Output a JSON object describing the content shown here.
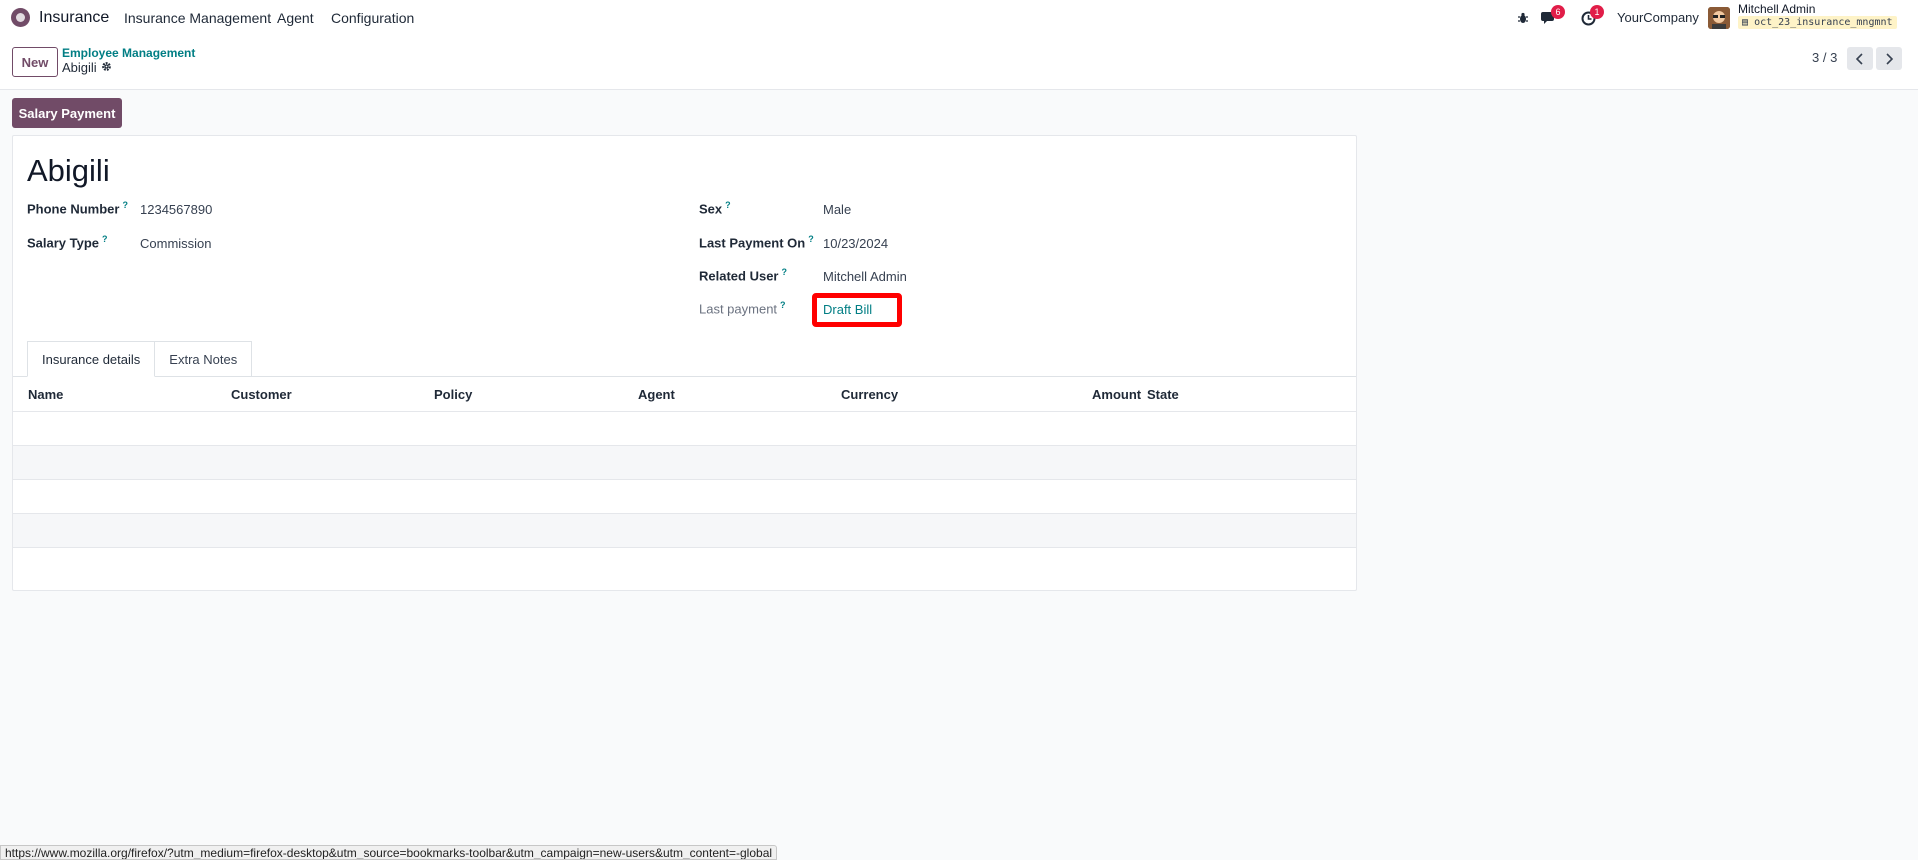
{
  "navbar": {
    "app_name": "Insurance",
    "menu": [
      "Insurance Management",
      "Agent",
      "Configuration"
    ],
    "messages_count": "6",
    "activities_count": "1",
    "company": "YourCompany",
    "user_name": "Mitchell Admin",
    "database": "oct_23_insurance_mngmnt"
  },
  "control_panel": {
    "new_label": "New",
    "breadcrumb_parent": "Employee Management",
    "breadcrumb_current": "Abigili",
    "pager": "3 / 3"
  },
  "form": {
    "action_button": "Salary Payment",
    "title": "Abigili",
    "fields_left": [
      {
        "label": "Phone Number",
        "value": "1234567890"
      },
      {
        "label": "Salary Type",
        "value": "Commission"
      }
    ],
    "fields_right": [
      {
        "label": "Sex",
        "value": "Male"
      },
      {
        "label": "Last Payment On",
        "value": "10/23/2024"
      },
      {
        "label": "Related User",
        "value": "Mitchell Admin"
      },
      {
        "label": "Last payment",
        "value": "Draft Bill"
      }
    ],
    "help_mark": "?",
    "tabs": [
      "Insurance details",
      "Extra Notes"
    ],
    "table_columns": [
      "Name",
      "Customer",
      "Policy",
      "Agent",
      "Currency",
      "Amount",
      "State"
    ]
  },
  "statusbar": {
    "url": "https://www.mozilla.org/firefox/?utm_medium=firefox-desktop&utm_source=bookmarks-toolbar&utm_campaign=new-users&utm_content=-global"
  },
  "colors": {
    "primary": "#714b67",
    "link": "#017e84",
    "highlight": "#ff0000",
    "badge": "#e11d48"
  }
}
